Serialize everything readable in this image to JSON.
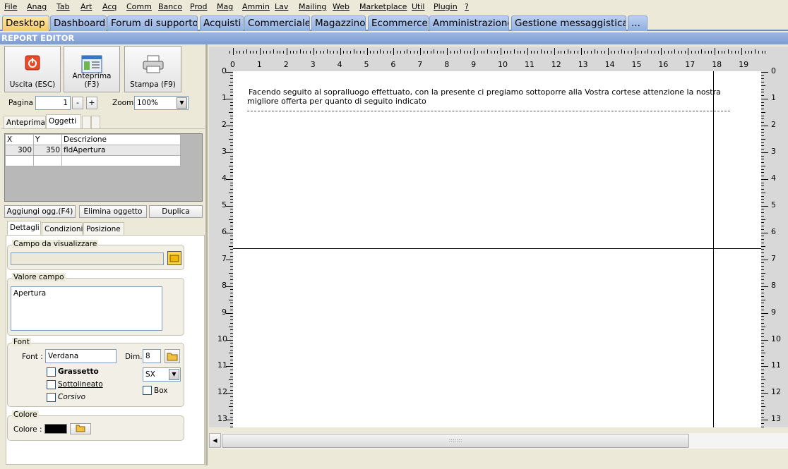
{
  "menu": [
    "File",
    "Anag",
    "Tab",
    "Art",
    "Acq",
    "Comm",
    "Banco",
    "Prod",
    "Mag",
    "Ammin",
    "Lav",
    "Mailing",
    "Web",
    "Marketplace",
    "Util",
    "Plugin",
    "?"
  ],
  "tabs": [
    "Desktop",
    "Dashboard",
    "Forum di supporto",
    "Acquisti",
    "Commerciale",
    "Magazzino",
    "Ecommerce",
    "Amministrazione",
    "Gestione messaggistica",
    "..."
  ],
  "window_title": "REPORT EDITOR",
  "toolbar": {
    "exit": "Uscita (ESC)",
    "preview": "Anteprima (F3)",
    "print": "Stampa (F9)"
  },
  "pagina": {
    "label": "Pagina",
    "value": "1",
    "minus": "-",
    "plus": "+"
  },
  "zoom": {
    "label": "Zoom",
    "value": "100%"
  },
  "top_tabs": [
    "Anteprima",
    "Oggetti"
  ],
  "objects_table": {
    "headers": [
      "X",
      "Y",
      "Descrizione"
    ],
    "rows": [
      [
        "300",
        "350",
        "fldApertura"
      ]
    ]
  },
  "object_buttons": {
    "add": "Aggiungi ogg.(F4)",
    "delete": "Elimina oggetto",
    "duplicate": "Duplica"
  },
  "detail_tabs": [
    "Dettagli",
    "Condizioni",
    "Posizione"
  ],
  "campo": {
    "title": "Campo da visualizzare",
    "value": ""
  },
  "valore": {
    "title": "Valore campo",
    "value": "Apertura"
  },
  "font": {
    "title": "Font",
    "font_label": "Font :",
    "font_value": "Verdana",
    "dim_label": "Dim.",
    "dim_value": "8",
    "bold": "Grassetto",
    "underline": "Sottolineato",
    "italic": "Corsivo",
    "align": "SX",
    "box": "Box"
  },
  "colore": {
    "title": "Colore",
    "label": "Colore :",
    "value": "#000000"
  },
  "ruler": {
    "h_labels": [
      "0",
      "1",
      "2",
      "3",
      "4",
      "5",
      "6",
      "7",
      "8",
      "9",
      "10",
      "11",
      "12",
      "13",
      "14",
      "15",
      "16",
      "17",
      "18",
      "19"
    ],
    "v_labels": [
      "0",
      "1",
      "2",
      "3",
      "4",
      "5",
      "6",
      "7",
      "8",
      "9",
      "10",
      "11",
      "12",
      "13"
    ]
  },
  "document": {
    "line1": "Facendo seguito al sopralluogo effettuato, con la presente ci pregiamo sottoporre alla Vostra cortese attenzione la nostra",
    "line2": "migliore offerta per quanto di seguito indicato"
  },
  "colors": {
    "tab_bg": "#9db6e4",
    "tab_active": "#f5c865",
    "title_bg": "#7c9cd0"
  }
}
